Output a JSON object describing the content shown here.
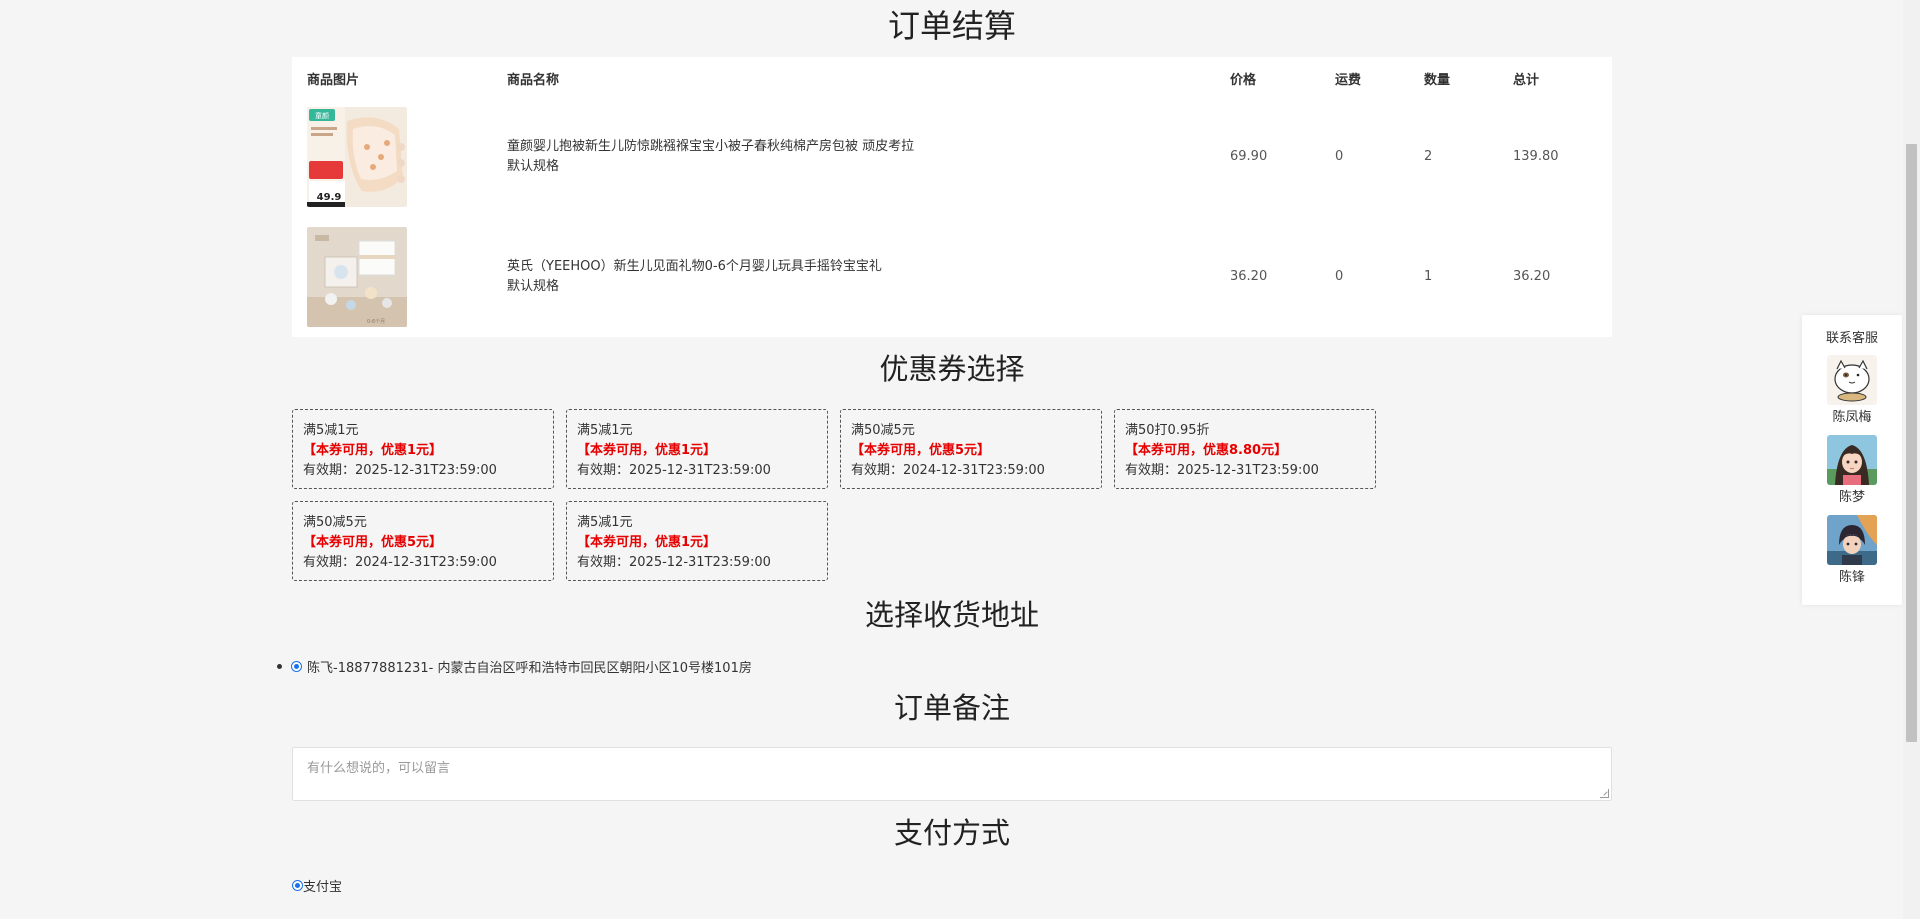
{
  "page": {
    "title": "订单结算"
  },
  "order_table": {
    "headers": {
      "image": "商品图片",
      "name": "商品名称",
      "price": "价格",
      "shipping": "运费",
      "quantity": "数量",
      "total": "总计"
    },
    "items": [
      {
        "name": "童颜婴儿抱被新生儿防惊跳襁褓宝宝小被子春秋纯棉产房包被 顽皮考拉",
        "spec": "默认规格",
        "price": "69.90",
        "shipping": "0",
        "quantity": "2",
        "total": "139.80",
        "image_icon": "baby-swaddle-product-image"
      },
      {
        "name": "英氏（YEEHOO）新生儿见面礼物0-6个月婴儿玩具手摇铃宝宝礼",
        "spec": "默认规格",
        "price": "36.20",
        "shipping": "0",
        "quantity": "1",
        "total": "36.20",
        "image_icon": "gift-box-product-image"
      }
    ]
  },
  "coupons": {
    "title": "优惠券选择",
    "items": [
      {
        "rule": "满5减1元",
        "status": "【本券可用，优惠1元】",
        "validity": "有效期：2025-12-31T23:59:00"
      },
      {
        "rule": "满5减1元",
        "status": "【本券可用，优惠1元】",
        "validity": "有效期：2025-12-31T23:59:00"
      },
      {
        "rule": "满50减5元",
        "status": "【本券可用，优惠5元】",
        "validity": "有效期：2024-12-31T23:59:00"
      },
      {
        "rule": "满50打0.95折",
        "status": "【本券可用，优惠8.80元】",
        "validity": "有效期：2025-12-31T23:59:00"
      },
      {
        "rule": "满50减5元",
        "status": "【本券可用，优惠5元】",
        "validity": "有效期：2024-12-31T23:59:00"
      },
      {
        "rule": "满5减1元",
        "status": "【本券可用，优惠1元】",
        "validity": "有效期：2025-12-31T23:59:00"
      }
    ]
  },
  "address": {
    "title": "选择收货地址",
    "selected": "陈飞-18877881231- 内蒙古自治区呼和浩特市回民区朝阳小区10号楼101房"
  },
  "remark": {
    "title": "订单备注",
    "placeholder": "有什么想说的，可以留言"
  },
  "payment": {
    "title": "支付方式",
    "method": "支付宝"
  },
  "customer_service": {
    "title": "联系客服",
    "agents": [
      {
        "name": "陈凤梅",
        "avatar_icon": "cartoon-cat-avatar"
      },
      {
        "name": "陈梦",
        "avatar_icon": "anime-girl-avatar"
      },
      {
        "name": "陈锋",
        "avatar_icon": "anime-boy-avatar"
      }
    ]
  },
  "colors": {
    "accent_red": "#e60000",
    "radio_blue": "#1a73e8",
    "background": "#f5f5f5"
  }
}
